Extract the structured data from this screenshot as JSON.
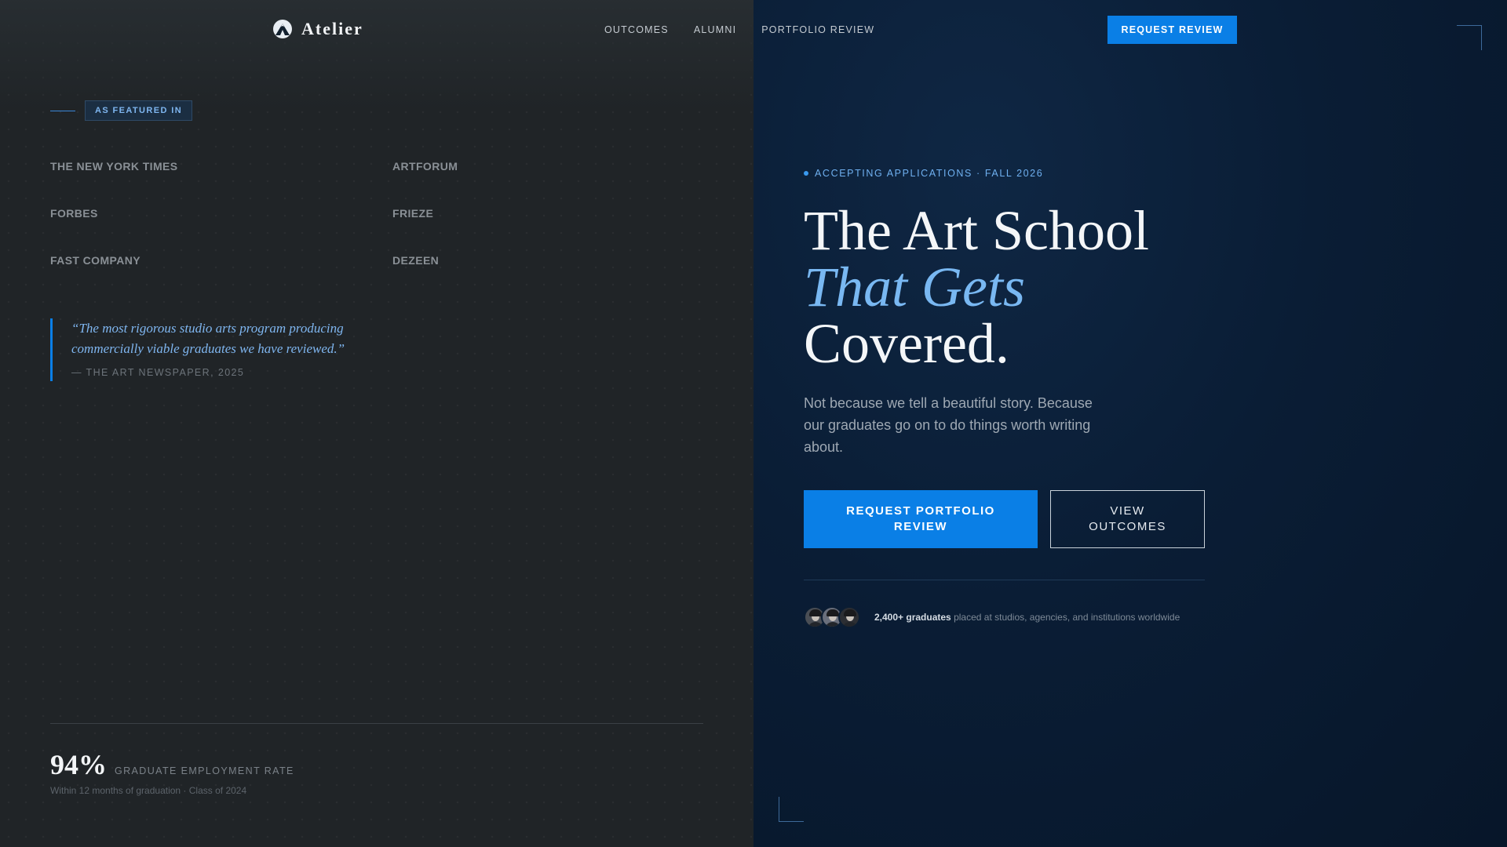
{
  "nav": {
    "brand": "Atelier",
    "links": [
      "OUTCOMES",
      "ALUMNI",
      "PORTFOLIO REVIEW"
    ],
    "cta": "REQUEST REVIEW"
  },
  "featured": {
    "badge": "AS FEATURED IN",
    "press": [
      "THE NEW YORK TIMES",
      "ARTFORUM",
      "FORBES",
      "FRIEZE",
      "FAST COMPANY",
      "DEZEEN"
    ],
    "quote": "“The most rigorous studio arts program producing commercially viable graduates we have reviewed.”",
    "quote_source": "— THE ART NEWSPAPER, 2025"
  },
  "stat": {
    "value": "94%",
    "label": "GRADUATE EMPLOYMENT RATE",
    "sub": "Within 12 months of graduation · Class of 2024"
  },
  "hero": {
    "eyebrow": "ACCEPTING APPLICATIONS · FALL 2026",
    "title_line1": "The Art School",
    "title_line2": "That Gets",
    "title_line3": "Covered.",
    "subtitle": "Not because we tell a beautiful story. Because our graduates go on to do things worth writing about.",
    "primary_cta": "REQUEST PORTFOLIO REVIEW",
    "secondary_cta": "VIEW OUTCOMES",
    "proof_strong": "2,400+ graduates",
    "proof_rest": " placed at studios, agencies, and institutions worldwide"
  },
  "colors": {
    "accent": "#0a7fe6",
    "accent_light": "#79b8f2",
    "left_bg": "#202427",
    "right_bg": "#0a1d35"
  },
  "icons": {
    "brand": "mountain-logo-icon",
    "eyebrow": "status-dot-icon"
  }
}
